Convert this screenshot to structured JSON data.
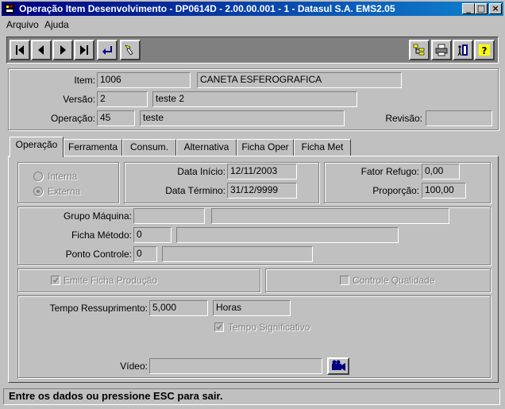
{
  "window": {
    "title": "Operação Item Desenvolvimento - DP0614D - 2.00.00.001 - 1 - Datasul S.A.    EMS2.05",
    "minimize": "_",
    "maximize": "□",
    "close": "×"
  },
  "menu": {
    "arquivo": "Arquivo",
    "ajuda": "Ajuda"
  },
  "header": {
    "item_label": "Item:",
    "item_code": "1006",
    "item_desc": "CANETA ESFEROGRAFICA",
    "item_extra": "",
    "versao_label": "Versão:",
    "versao_code": "2",
    "versao_desc": "teste 2",
    "operacao_label": "Operação:",
    "operacao_code": "45",
    "operacao_desc": "teste",
    "revisao_label": "Revisão:",
    "revisao_value": ""
  },
  "tabs": [
    "Operação",
    "Ferramenta",
    "Consum.",
    "Alternativa",
    "Ficha Oper",
    "Ficha Met"
  ],
  "operacao": {
    "interna": "Interna",
    "externa": "Externa",
    "data_inicio_label": "Data Início:",
    "data_inicio": "12/11/2003",
    "data_termino_label": "Data Término:",
    "data_termino": "31/12/9999",
    "fator_refugo_label": "Fator Refugo:",
    "fator_refugo": "0,00",
    "proporcao_label": "Proporção:",
    "proporcao": "100,00",
    "grupo_maquina_label": "Grupo Máquina:",
    "grupo_maquina": "",
    "grupo_maquina_desc": "",
    "ficha_metodo_label": "Ficha Método:",
    "ficha_metodo": "0",
    "ficha_metodo_desc": "",
    "ponto_controle_label": "Ponto Controle:",
    "ponto_controle": "0",
    "ponto_controle_desc": "",
    "emite_ficha": "Emite Ficha Produção",
    "controle_qualidade": "Controle Qualidade",
    "tempo_ressup_label": "Tempo Ressuprimento:",
    "tempo_ressup": "5,000",
    "tempo_unidade": "Horas",
    "tempo_significativo": "Tempo Significativo",
    "video_label": "Vídeo:",
    "video": ""
  },
  "status": "Entre os dados ou pressione ESC para sair."
}
